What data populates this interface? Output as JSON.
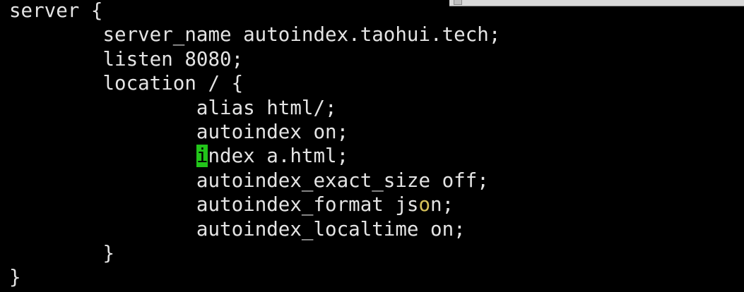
{
  "terminal": {
    "background": "#000000",
    "foreground": "#e4e4e4",
    "cursor_color": "#22c51a",
    "mouse_ibeam_color": "#d6c25a",
    "lines": [
      {
        "indent": "",
        "text": "server {"
      },
      {
        "indent": "        ",
        "text": "server_name autoindex.taohui.tech;"
      },
      {
        "indent": "        ",
        "text": "listen 8080;"
      },
      {
        "indent": "        ",
        "text": "location / {"
      },
      {
        "indent": "                ",
        "text": "alias html/;"
      },
      {
        "indent": "                ",
        "text": "autoindex on;"
      },
      {
        "indent": "                ",
        "cursor_char": "i",
        "text": "ndex a.html;"
      },
      {
        "indent": "                ",
        "text": "autoindex_exact_size off;"
      },
      {
        "indent": "                ",
        "pre": "autoindex_format js",
        "ibeam": "o",
        "post": "n;"
      },
      {
        "indent": "                ",
        "text": "autoindex_localtime on;"
      },
      {
        "indent": "        ",
        "text": "}"
      },
      {
        "indent": "",
        "text": "}"
      }
    ]
  }
}
